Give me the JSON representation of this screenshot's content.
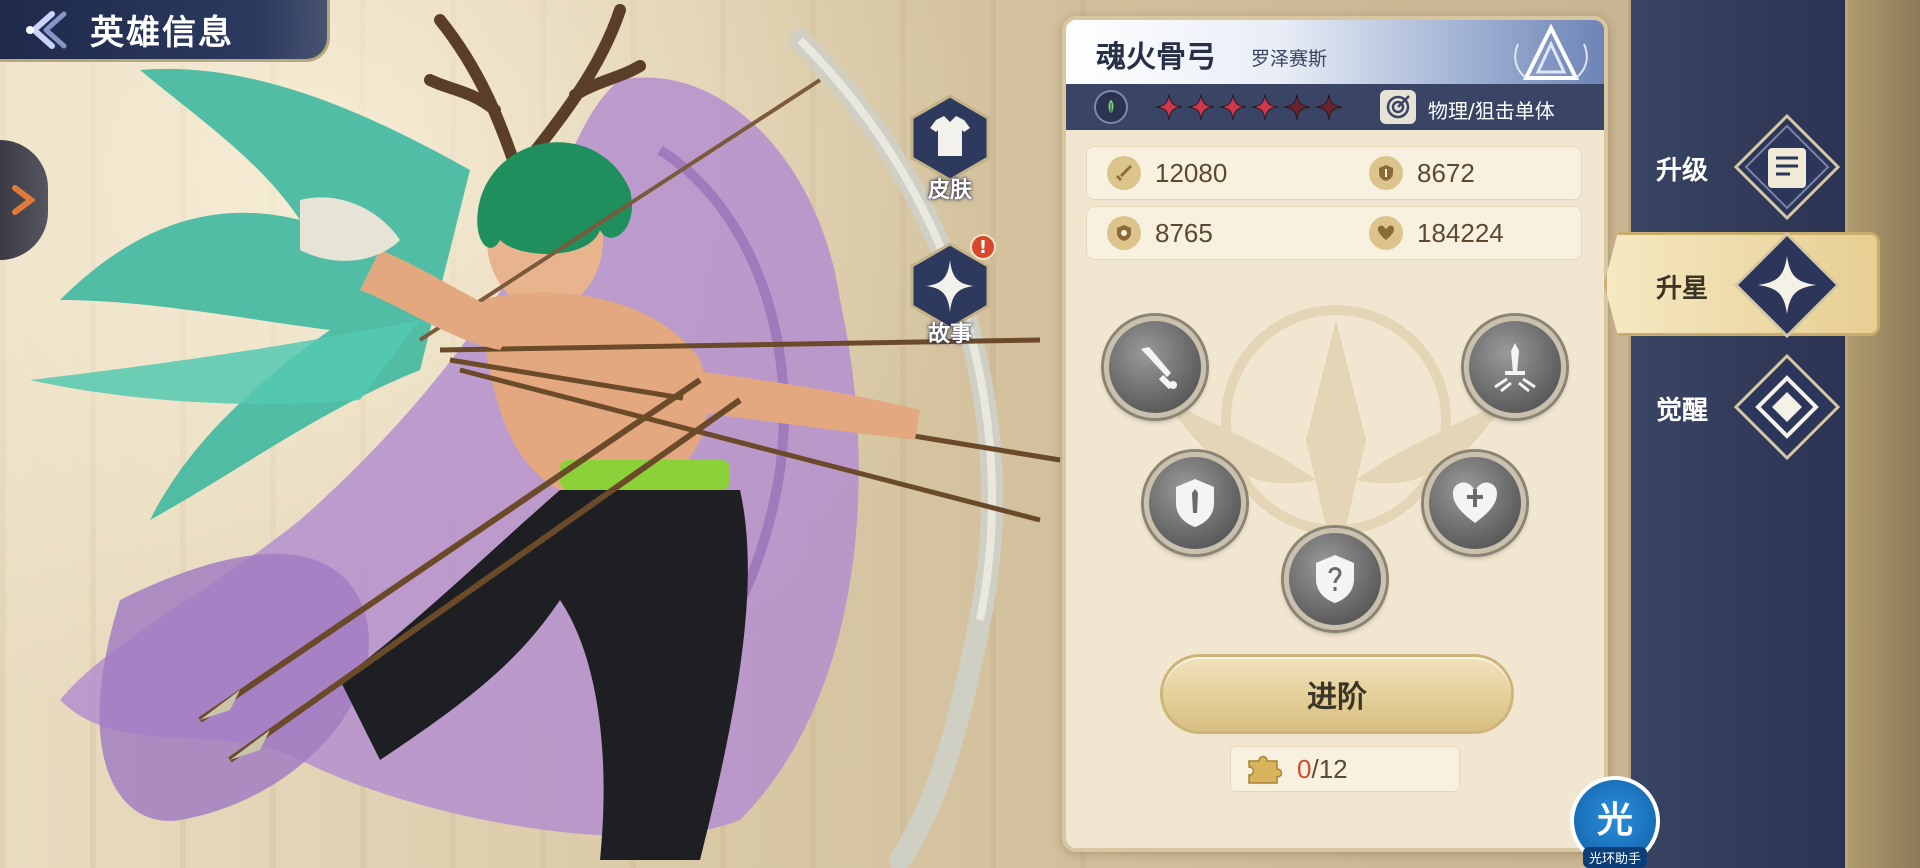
{
  "header": {
    "title": "英雄信息"
  },
  "side_buttons": {
    "skin_label": "皮肤",
    "story_label": "故事",
    "story_alert": "!"
  },
  "hero": {
    "name": "魂火骨弓",
    "subtitle": "罗泽赛斯",
    "stars_total": 6,
    "stars_lit": 4,
    "role": "物理/狙击单体",
    "element_icon": "leaf-icon",
    "stats": [
      {
        "icon": "sword-icon",
        "value": "12080"
      },
      {
        "icon": "shield-icon",
        "value": "8672"
      },
      {
        "icon": "magic-shield-icon",
        "value": "8765"
      },
      {
        "icon": "heart-icon",
        "value": "184224"
      }
    ]
  },
  "skill_nodes": [
    {
      "icon": "sword-icon"
    },
    {
      "icon": "dagger-icon"
    },
    {
      "icon": "shield-icon"
    },
    {
      "icon": "heart-icon"
    },
    {
      "icon": "magic-shield-icon"
    }
  ],
  "advance": {
    "label": "进阶",
    "progress_current": "0",
    "progress_max": "/12"
  },
  "nav": {
    "upgrade": "升级",
    "star_up": "升星",
    "awaken": "觉醒"
  },
  "assistant": {
    "glyph": "光",
    "label": "光环助手"
  },
  "colors": {
    "panel_bg": "#f1e6cf",
    "rail_bg": "#2b3452",
    "accent_gold": "#d8bf83",
    "star_red": "#d2384a",
    "star_dim": "#6e2230"
  }
}
